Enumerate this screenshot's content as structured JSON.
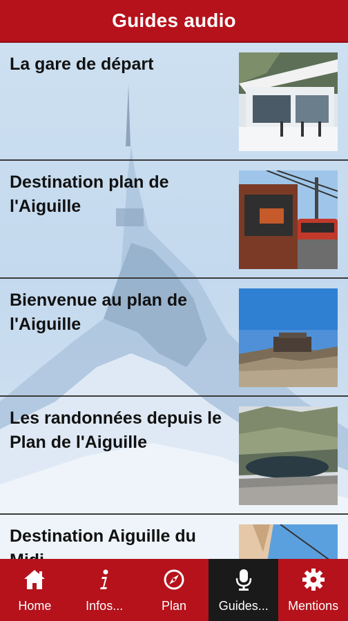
{
  "header": {
    "title": "Guides audio"
  },
  "guides": [
    {
      "title": "La gare de départ"
    },
    {
      "title": "Destination plan de l'Aiguille"
    },
    {
      "title": "Bienvenue au plan de l'Aiguille"
    },
    {
      "title": "Les randonnées depuis le Plan de l'Aiguille"
    },
    {
      "title": "Destination Aiguille du Midi"
    }
  ],
  "tabs": [
    {
      "label": "Home",
      "icon": "home-icon"
    },
    {
      "label": "Infos...",
      "icon": "info-icon"
    },
    {
      "label": "Plan",
      "icon": "compass-icon"
    },
    {
      "label": "Guides...",
      "icon": "microphone-icon",
      "active": true
    },
    {
      "label": "Mentions",
      "icon": "gear-icon"
    }
  ],
  "colors": {
    "brand_red": "#b5121b",
    "active_tab": "#1a1a1a",
    "background": "#c9dcee"
  }
}
